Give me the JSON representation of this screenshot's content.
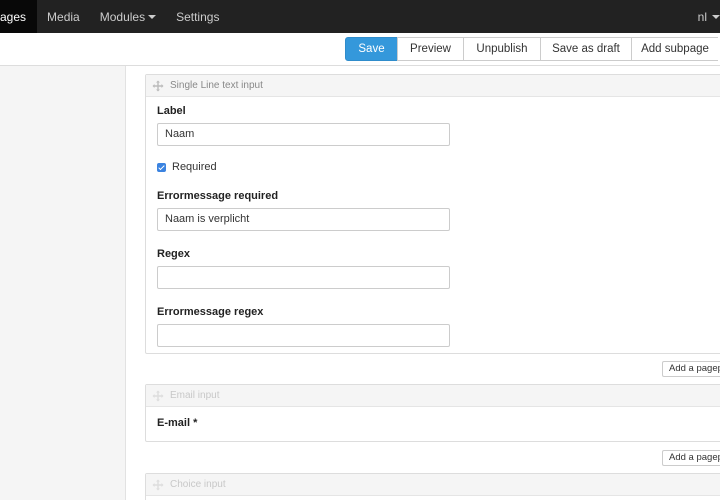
{
  "topnav": {
    "items": [
      {
        "label": "ages",
        "active": true
      },
      {
        "label": "Media",
        "active": false
      },
      {
        "label": "Modules",
        "active": false,
        "dropdown": true
      },
      {
        "label": "Settings",
        "active": false
      }
    ],
    "language": "nl"
  },
  "toolbar": {
    "save_label": "Save",
    "preview_label": "Preview",
    "unpublish_label": "Unpublish",
    "save_draft_label": "Save as draft",
    "add_subpage_label": "Add subpage"
  },
  "blocks": {
    "single_line": {
      "title": "Single Line text input",
      "label_heading": "Label",
      "label_value": "Naam",
      "required_label": "Required",
      "required_checked": true,
      "err_required_heading": "Errormessage required",
      "err_required_value": "Naam is verplicht",
      "regex_heading": "Regex",
      "regex_value": "",
      "err_regex_heading": "Errormessage regex",
      "err_regex_value": ""
    },
    "add_1": "Add a pagep",
    "email": {
      "title": "Email input",
      "field_label": "E-mail *"
    },
    "add_2": "Add a pagep",
    "choice": {
      "title": "Choice input"
    }
  },
  "colors": {
    "nav_bg": "#222222",
    "primary": "#3498db",
    "checkbox": "#3b83e0"
  }
}
